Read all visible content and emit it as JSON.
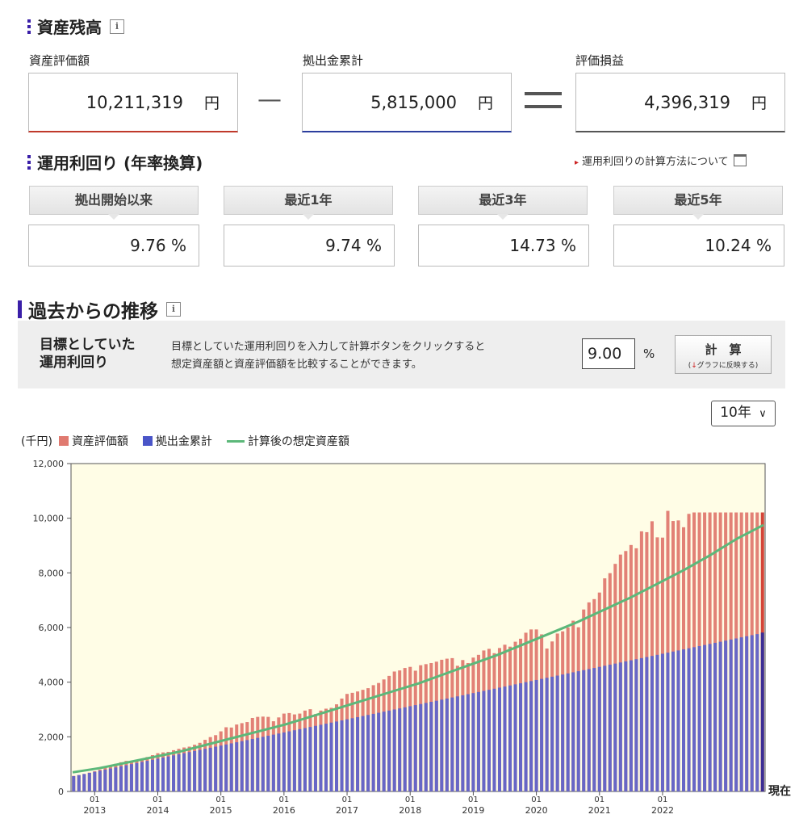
{
  "balance": {
    "title": "資産残高",
    "info_icon": "i",
    "eval_label": "資産評価額",
    "eval_value": "10,211,319",
    "contrib_label": "拠出金累計",
    "contrib_value": "5,815,000",
    "gain_label": "評価損益",
    "gain_value": "4,396,319",
    "unit": "円",
    "minus_sign": "—",
    "equals_sign": "="
  },
  "returns": {
    "title": "運用利回り (年率換算)",
    "calc_link": "運用利回りの計算方法について",
    "items": [
      {
        "label": "拠出開始以来",
        "value": "9.76 %"
      },
      {
        "label": "最近1年",
        "value": "9.74 %"
      },
      {
        "label": "最近3年",
        "value": "14.73 %"
      },
      {
        "label": "最近5年",
        "value": "10.24 %"
      }
    ]
  },
  "history": {
    "title": "過去からの推移",
    "info_icon": "i",
    "target_label_1": "目標としていた",
    "target_label_2": "運用利回り",
    "target_desc_1": "目標としていた運用利回りを入力して計算ボタンをクリックすると",
    "target_desc_2": "想定資産額と資産評価額を比較することができます。",
    "target_rate": "9.00",
    "percent": "%",
    "calc_button": "計　算",
    "calc_button_sub": "グラフに反映する",
    "period_select": "10年",
    "legend_unit": "(千円)",
    "legend": [
      "資産評価額",
      "拠出金累計",
      "計算後の想定資産額"
    ],
    "now_label": "現在"
  },
  "colors": {
    "eval": "#e07a70",
    "contrib": "#5a63cf",
    "expected": "#5cb87a",
    "chart_bg": "#fffde6",
    "accent": "#3a1fa8"
  },
  "chart_data": {
    "type": "bar",
    "ylim": [
      0,
      12000
    ],
    "yticks": [
      "0",
      "2,000",
      "4,000",
      "6,000",
      "8,000",
      "10,000",
      "12,000"
    ],
    "ytick_values": [
      0,
      2000,
      4000,
      6000,
      8000,
      10000,
      12000
    ],
    "x_month_label": "01",
    "x_years": [
      "2013",
      "2014",
      "2015",
      "2016",
      "2017",
      "2018",
      "2019",
      "2020",
      "2021",
      "2022"
    ],
    "start": "2012-09",
    "series": [
      {
        "name": "資産評価額",
        "type": "bar",
        "values": [
          570,
          600,
          640,
          690,
          740,
          800,
          880,
          950,
          1010,
          1070,
          1120,
          1100,
          1130,
          1160,
          1260,
          1330,
          1400,
          1430,
          1450,
          1510,
          1560,
          1610,
          1640,
          1710,
          1780,
          1890,
          1990,
          2060,
          2200,
          2350,
          2340,
          2450,
          2500,
          2540,
          2690,
          2730,
          2740,
          2730,
          2570,
          2710,
          2850,
          2870,
          2820,
          2850,
          2960,
          3010,
          2830,
          2960,
          3030,
          3060,
          3190,
          3400,
          3570,
          3610,
          3660,
          3720,
          3780,
          3890,
          3970,
          4100,
          4230,
          4390,
          4430,
          4520,
          4560,
          4420,
          4620,
          4660,
          4700,
          4750,
          4820,
          4860,
          4880,
          4600,
          4810,
          4700,
          4900,
          5000,
          5160,
          5220,
          5060,
          5250,
          5370,
          5300,
          5480,
          5590,
          5810,
          5930,
          5930,
          5750,
          5230,
          5490,
          5780,
          5860,
          6000,
          6250,
          6010,
          6660,
          6920,
          7040,
          7280,
          7800,
          7990,
          8330,
          8670,
          8800,
          9020,
          8900,
          9520,
          9490,
          9890,
          9300,
          9290,
          10270,
          9900,
          9920,
          9670,
          10160,
          10211
        ]
      },
      {
        "name": "拠出金累計",
        "type": "bar",
        "values": [
          560,
          600,
          640,
          680,
          720,
          760,
          800,
          840,
          880,
          920,
          960,
          1000,
          1040,
          1080,
          1120,
          1160,
          1200,
          1240,
          1280,
          1320,
          1360,
          1400,
          1440,
          1480,
          1520,
          1560,
          1600,
          1640,
          1680,
          1720,
          1760,
          1800,
          1840,
          1880,
          1920,
          1960,
          2000,
          2040,
          2080,
          2120,
          2160,
          2200,
          2240,
          2280,
          2320,
          2360,
          2400,
          2440,
          2480,
          2520,
          2560,
          2600,
          2640,
          2680,
          2720,
          2760,
          2800,
          2840,
          2880,
          2920,
          2960,
          3000,
          3040,
          3080,
          3120,
          3160,
          3200,
          3240,
          3280,
          3320,
          3360,
          3400,
          3440,
          3480,
          3520,
          3560,
          3600,
          3640,
          3680,
          3720,
          3760,
          3800,
          3840,
          3880,
          3920,
          3960,
          4000,
          4040,
          4080,
          4120,
          4160,
          4200,
          4240,
          4280,
          4320,
          4360,
          4400,
          4440,
          4480,
          4520,
          4560,
          4600,
          4640,
          4680,
          4720,
          4760,
          4800,
          4840,
          4880,
          4920,
          4960,
          5000,
          5040,
          5080,
          5120,
          5160,
          5200,
          5240,
          5280,
          5320,
          5360,
          5400,
          5440,
          5480,
          5520,
          5560,
          5600,
          5640,
          5680,
          5720,
          5760,
          5815
        ]
      },
      {
        "name": "計算後の想定資産額",
        "type": "line",
        "values": [
          700,
          850,
          1050,
          1250,
          1450,
          1700,
          1950,
          2200,
          2450,
          2750,
          3050,
          3350,
          3650,
          3950,
          4300,
          4650,
          5000,
          5400,
          5800,
          6200,
          6650,
          7100,
          7600,
          8100,
          8650,
          9250,
          9750
        ]
      }
    ]
  }
}
